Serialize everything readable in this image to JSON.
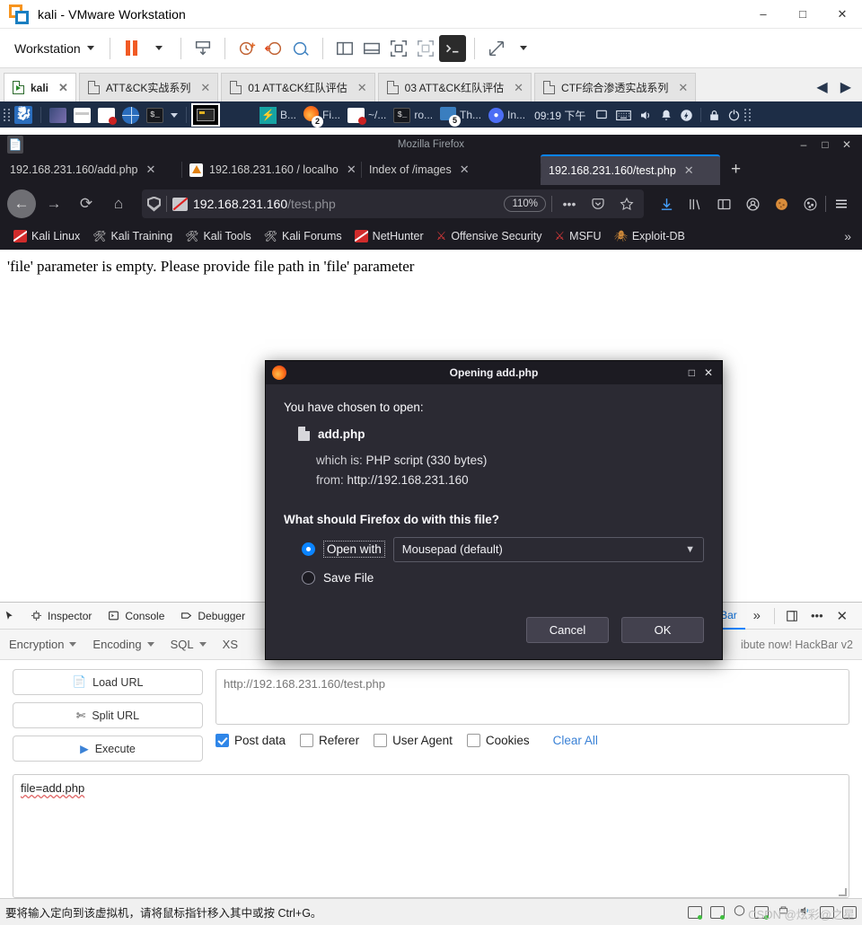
{
  "vmware": {
    "title": "kali - VMware Workstation",
    "window_buttons": [
      "–",
      "□",
      "✕"
    ],
    "menu_label": "Workstation",
    "toolbar_icons": [
      "pause-icon",
      "pause-dropdown",
      "snapshot-manager-icon",
      "take-snapshot-icon",
      "revert-snapshot-icon",
      "manage-snapshots-icon",
      "show-library-icon",
      "show-thumbnails-icon",
      "full-screen-icon",
      "unity-mode-icon",
      "console-view-icon",
      "send-key-icon"
    ],
    "tabs": [
      {
        "label": "kali",
        "active": true
      },
      {
        "label": "ATT&CK实战系列",
        "active": false
      },
      {
        "label": "01 ATT&CK红队评估",
        "active": false
      },
      {
        "label": "03 ATT&CK红队评估",
        "active": false
      },
      {
        "label": "CTF综合渗透实战系列",
        "active": false
      }
    ],
    "tab_nav_prev": "◀",
    "tab_nav_next": "▶",
    "status_text": "要将输入定向到该虚拟机，请将鼠标指针移入其中或按 Ctrl+G。",
    "watermark": "CSDN @炫彩@之星"
  },
  "kali_panel": {
    "launcher_icons": [
      "kali-menu-icon",
      "terminal-emulator-icon",
      "file-manager-icon",
      "text-editor-icon",
      "web-browser-icon",
      "root-terminal-icon",
      "window-list-icon"
    ],
    "window_buttons": [
      {
        "label": "B...",
        "icon": "burpsuite-icon"
      },
      {
        "label": "Fi...",
        "icon": "firefox-icon",
        "badge": "2"
      },
      {
        "label": "~/...",
        "icon": "document-icon"
      },
      {
        "label": "ro...",
        "icon": "terminal-icon"
      },
      {
        "label": "Th...",
        "icon": "thunar-icon",
        "badge": "5"
      },
      {
        "label": "In...",
        "icon": "browser-icon"
      }
    ],
    "clock": "09:19 下午",
    "tray_icons": [
      "display-icon",
      "keyboard-icon",
      "volume-icon",
      "notification-icon",
      "power-icon",
      "lock-icon",
      "logout-icon"
    ]
  },
  "firefox": {
    "window_title": "Mozilla Firefox",
    "window_buttons": [
      "–",
      "□",
      "✕"
    ],
    "tabs": [
      {
        "label": "192.168.231.160/add.php",
        "active": false,
        "favicon": "none"
      },
      {
        "label": "192.168.231.160 / localho",
        "active": false,
        "favicon": "phpmyadmin-icon"
      },
      {
        "label": "Index of /images",
        "active": false,
        "favicon": "none"
      },
      {
        "label": "192.168.231.160/test.php",
        "active": true,
        "favicon": "none"
      }
    ],
    "new_tab_label": "+",
    "nav": {
      "back": "←",
      "forward": "→",
      "reload": "⟳",
      "home": "⌂",
      "url_host": "192.168.231.160",
      "url_path": "/test.php",
      "zoom_level": "110%",
      "more_actions": "•••",
      "pocket": "pocket-icon",
      "bookmark_star": "star-icon",
      "right_icons": [
        "downloads-icon",
        "library-icon",
        "sidebar-icon",
        "account-icon",
        "hackbar-icon",
        "cookie-manager-icon",
        "hamburger-menu-icon"
      ]
    },
    "bookmarks": [
      {
        "label": "Kali Linux",
        "icon": "kali-icon"
      },
      {
        "label": "Kali Training",
        "icon": "wrench-icon"
      },
      {
        "label": "Kali Tools",
        "icon": "wrench-icon"
      },
      {
        "label": "Kali Forums",
        "icon": "wrench-icon"
      },
      {
        "label": "NetHunter",
        "icon": "kali-icon"
      },
      {
        "label": "Offensive Security",
        "icon": "offsec-icon"
      },
      {
        "label": "MSFU",
        "icon": "metasploit-icon"
      },
      {
        "label": "Exploit-DB",
        "icon": "exploitdb-icon"
      }
    ],
    "bookmarks_overflow": "»",
    "page_message": "'file' parameter is empty. Please provide file path in 'file' parameter"
  },
  "dialog": {
    "title": "Opening add.php",
    "window_buttons": [
      "□",
      "✕"
    ],
    "intro": "You have chosen to open:",
    "filename": "add.php",
    "which_is_label": "which is:",
    "which_is_value": "PHP script (330 bytes)",
    "from_label": "from:",
    "from_value": "http://192.168.231.160",
    "question": "What should Firefox do with this file?",
    "open_with_label": "Open with",
    "open_with_selected": true,
    "app_select_value": "Mousepad (default)",
    "save_file_label": "Save File",
    "save_file_selected": false,
    "cancel_label": "Cancel",
    "ok_label": "OK"
  },
  "devtools": {
    "tools": [
      {
        "label": "Inspector",
        "icon": "inspector-icon",
        "active": false
      },
      {
        "label": "Console",
        "icon": "console-icon",
        "active": false
      },
      {
        "label": "Debugger",
        "icon": "debugger-icon",
        "active": false
      },
      {
        "label": "kBar",
        "icon": "hackbar-icon",
        "active": true
      }
    ],
    "picker_icon": "element-picker-icon",
    "overflow": "»",
    "dock_icon": "dock-toggle-icon",
    "meatball": "•••",
    "close": "✕"
  },
  "hackbar": {
    "menus": [
      "Encryption",
      "Encoding",
      "SQL",
      "XS"
    ],
    "promo_text": "ibute now! HackBar v2",
    "buttons": [
      {
        "label": "Load URL",
        "icon": "load-url-icon"
      },
      {
        "label": "Split URL",
        "icon": "split-url-icon"
      },
      {
        "label": "Execute",
        "icon": "execute-icon"
      }
    ],
    "url_value": "http://192.168.231.160/test.php",
    "checkboxes": [
      {
        "label": "Post data",
        "checked": true
      },
      {
        "label": "Referer",
        "checked": false
      },
      {
        "label": "User Agent",
        "checked": false
      },
      {
        "label": "Cookies",
        "checked": false
      }
    ],
    "clear_all_label": "Clear All",
    "post_data_value": "file=add.php"
  }
}
